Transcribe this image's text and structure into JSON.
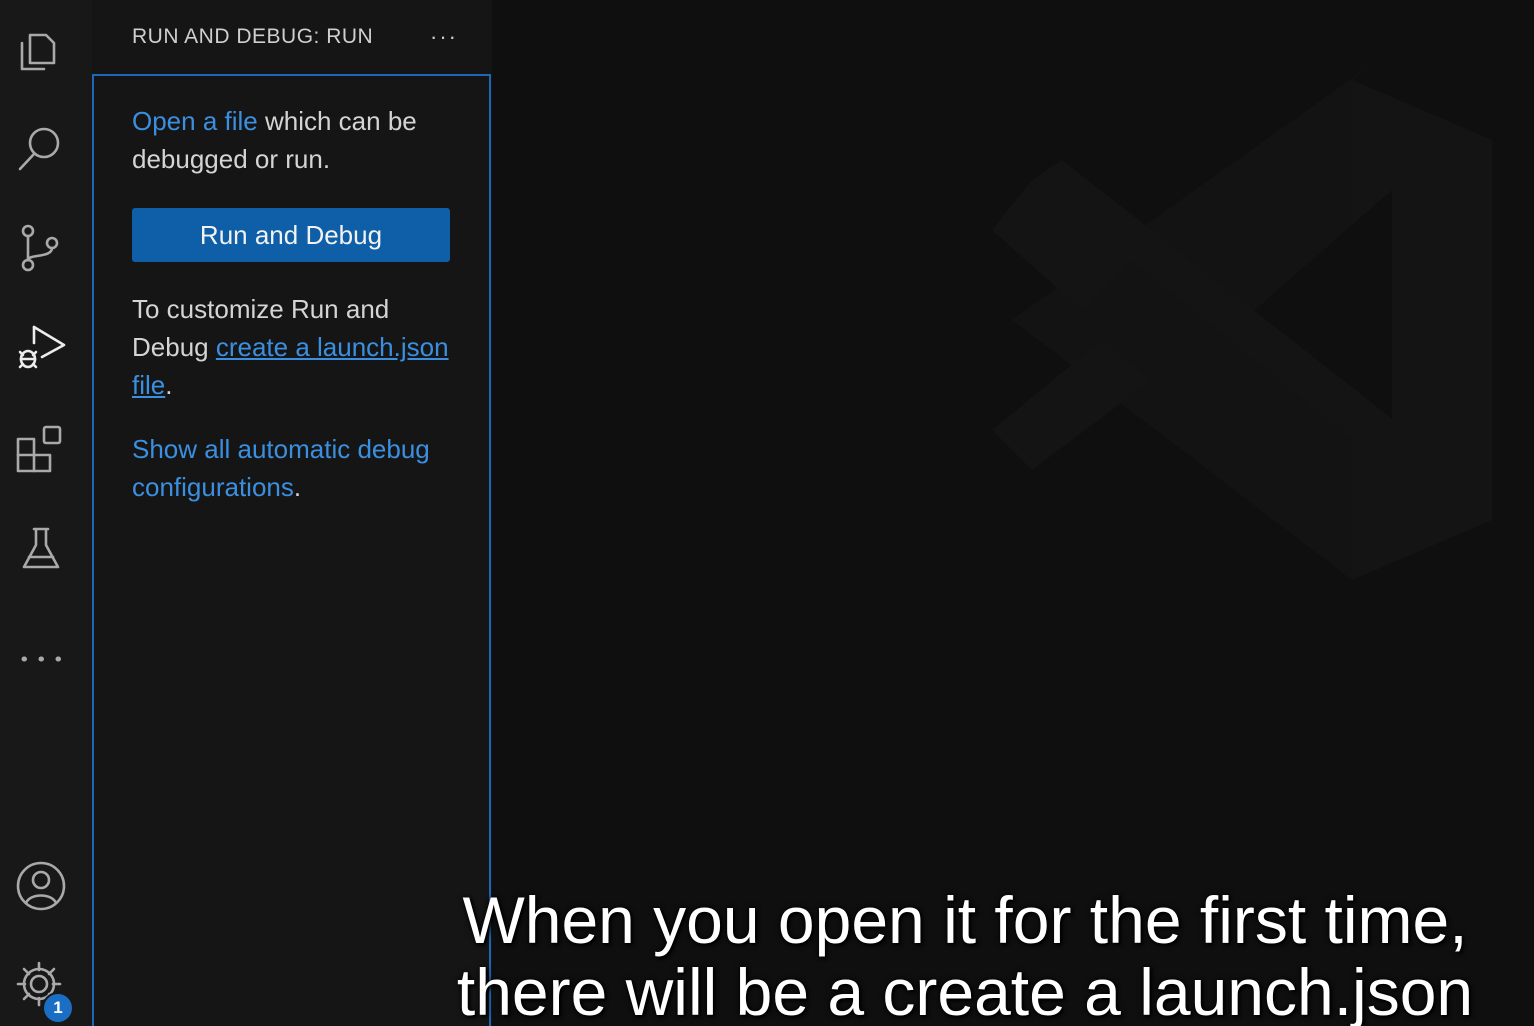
{
  "activity_bar": {
    "items": [
      {
        "name": "explorer",
        "icon": "files-icon"
      },
      {
        "name": "search",
        "icon": "search-icon"
      },
      {
        "name": "source-control",
        "icon": "source-control-icon"
      },
      {
        "name": "run-and-debug",
        "icon": "run-debug-icon",
        "active": true
      },
      {
        "name": "extensions",
        "icon": "extensions-icon"
      },
      {
        "name": "testing",
        "icon": "flask-icon"
      },
      {
        "name": "more",
        "icon": "more-icon"
      }
    ],
    "bottom": [
      {
        "name": "accounts",
        "icon": "account-icon"
      },
      {
        "name": "manage",
        "icon": "gear-icon",
        "badge": "1"
      }
    ]
  },
  "sidebar": {
    "title": "RUN AND DEBUG: RUN",
    "more_actions": "···",
    "intro_link": "Open a file",
    "intro_text": " which can be debugged or run.",
    "run_button": "Run and Debug",
    "customize_text": "To customize Run and Debug ",
    "customize_link": "create a launch.json file",
    "customize_end": ".",
    "show_link": "Show all automatic debug configurations",
    "show_end": "."
  },
  "subtitles": {
    "line1": "When you open it for the first time,",
    "line2": "there will be a create a launch.json"
  },
  "colors": {
    "accent": "#1d68b6",
    "link": "#3b8fe0",
    "button": "#0e5ea8",
    "badge": "#1a6fc4"
  }
}
